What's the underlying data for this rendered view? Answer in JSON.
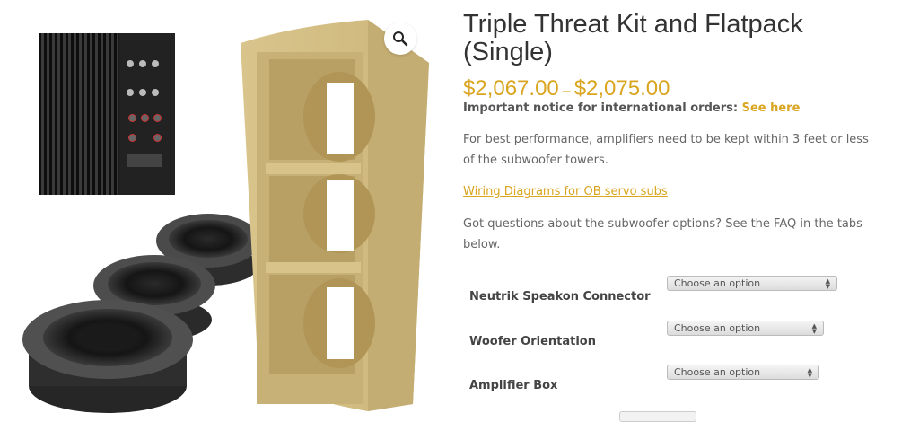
{
  "product": {
    "title": "Triple Threat Kit and Flatpack (Single)",
    "price_low": "$2,067.00",
    "price_sep": "–",
    "price_high": "$2,075.00"
  },
  "notice": {
    "text": "Important notice for international orders:",
    "link": "See here"
  },
  "description": {
    "p1": "For best performance, amplifiers need to be kept within 3 feet or less of the subwoofer towers.",
    "wiring_link": "Wiring Diagrams for OB servo subs",
    "p2": "Got questions about the subwoofer options? See the FAQ in the tabs below."
  },
  "options": [
    {
      "label": "Neutrik Speakon Connector",
      "value": "Choose an option"
    },
    {
      "label": "Woofer Orientation",
      "value": "Choose an option"
    },
    {
      "label": "Amplifier Box",
      "value": "Choose an option"
    }
  ],
  "icons": {
    "zoom": "magnifier-icon",
    "select_arrow": "up-down-arrow-icon"
  },
  "colors": {
    "accent": "#daa520",
    "title": "#333333",
    "body": "#666666"
  }
}
